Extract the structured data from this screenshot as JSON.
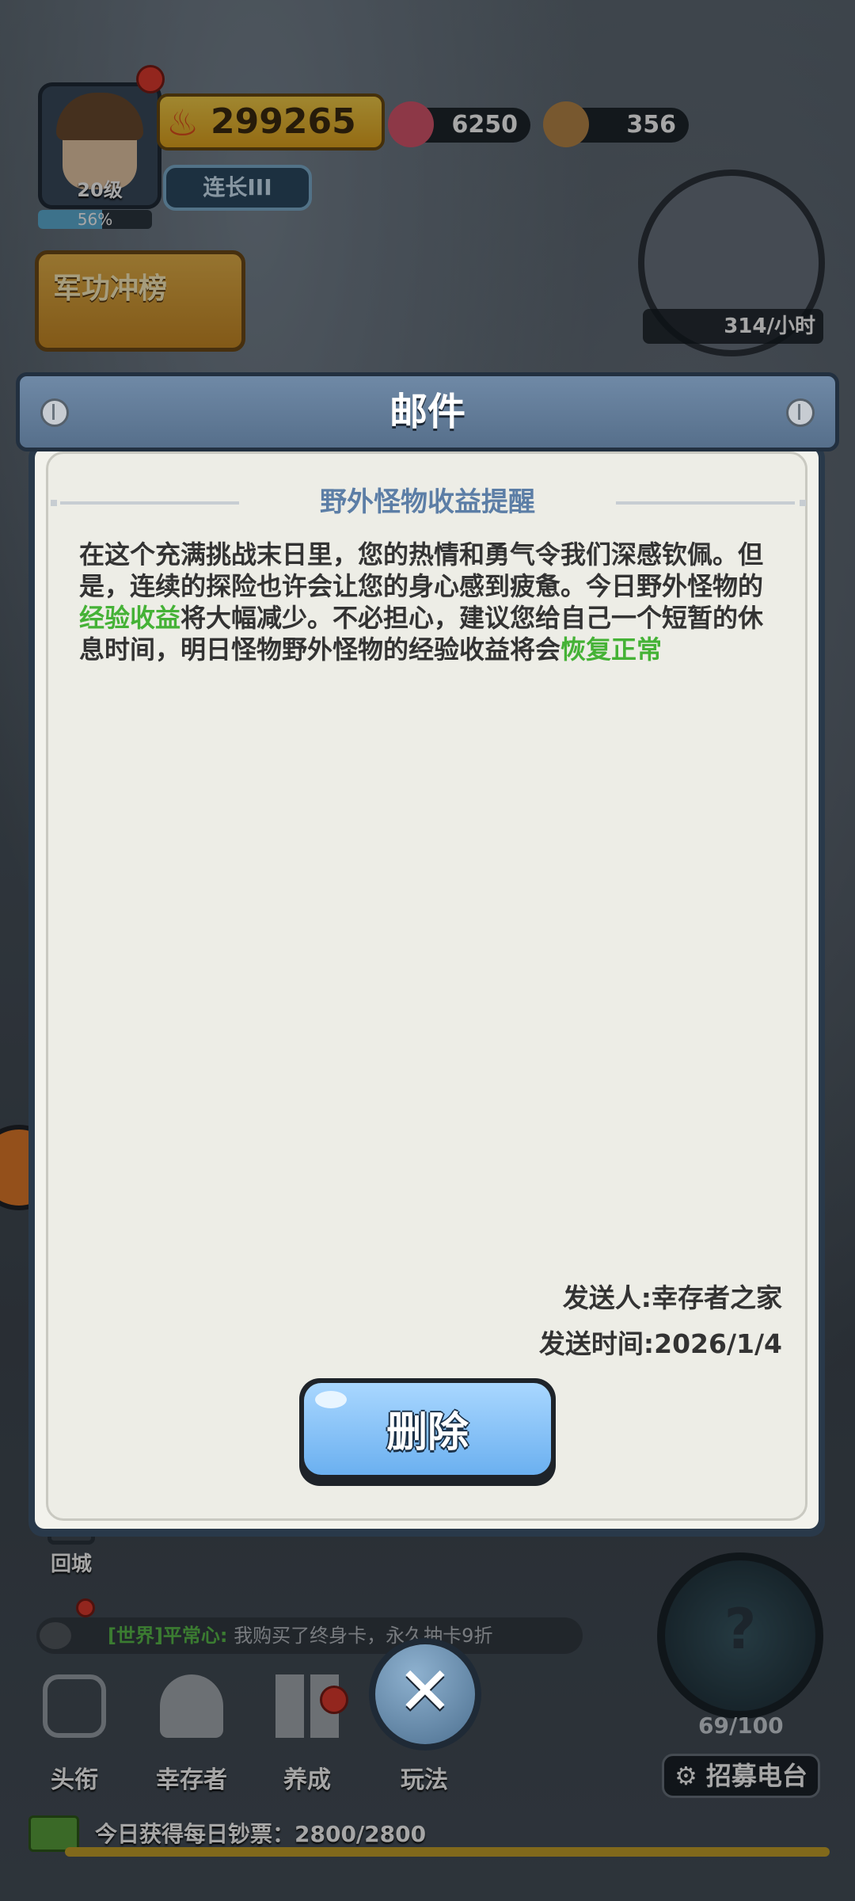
{
  "hud": {
    "level": "20级",
    "xp_percent": "56%",
    "xp_fraction": 0.56,
    "power": "299265",
    "gems": "6250",
    "wood": "356",
    "rank": "连长III",
    "merit_button": "军功冲榜",
    "income": "314/小时"
  },
  "dialog": {
    "title": "邮件",
    "subject": "野外怪物收益提醒",
    "body_part1": "在这个充满挑战末日里，您的热情和勇气令我们深感钦佩。但是，连续的探险也许会让您的身心感到疲惫。今日野外怪物的",
    "highlight1": "经验收益",
    "body_part2": "将大幅减少。不必担心，建议您给自己一个短暂的休息时间，明日怪物野外怪物的经验收益将会",
    "highlight2": "恢复正常",
    "sender": "发送人:幸存者之家",
    "send_time": "发送时间:2026/1/4",
    "delete_label": "删除"
  },
  "bottom": {
    "back_town": "回城",
    "chat_channel": "[世界]平常心:",
    "chat_message": "我购买了终身卡，永久抽卡9折",
    "nav": [
      "头衔",
      "幸存者",
      "养成",
      "玩法"
    ],
    "close_label": "✕",
    "recruit_count": "69/100",
    "recruit_label": "招募电台",
    "radar_symbol": "?",
    "daily_text": "今日获得每日钞票：2800/2800"
  },
  "colors": {
    "highlight": "#45b236",
    "subject": "#5c7ea6",
    "title_bar": "#6f89a6",
    "button": "#6bb0f0"
  }
}
